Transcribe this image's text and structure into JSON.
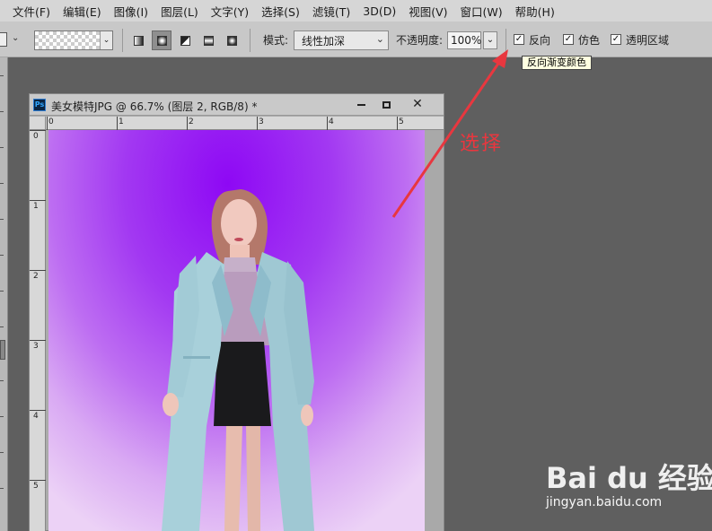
{
  "menu": [
    "文件(F)",
    "编辑(E)",
    "图像(I)",
    "图层(L)",
    "文字(Y)",
    "选择(S)",
    "滤镜(T)",
    "3D(D)",
    "视图(V)",
    "窗口(W)",
    "帮助(H)"
  ],
  "options": {
    "mode_label": "模式:",
    "mode_value": "线性加深",
    "opacity_label": "不透明度:",
    "opacity_value": "100%",
    "reverse_label": "反向",
    "dither_label": "仿色",
    "transparency_label": "透明区域",
    "reverse_checked": true,
    "dither_checked": true,
    "transparency_checked": true,
    "tooltip": "反向渐变颜色"
  },
  "document": {
    "title": "美女模特JPG @ 66.7% (图层 2, RGB/8) *",
    "app_icon": "Ps",
    "ruler_top": [
      "0",
      "1",
      "2",
      "3",
      "4",
      "5"
    ],
    "ruler_left": [
      "0",
      "1",
      "2",
      "3",
      "4",
      "5"
    ]
  },
  "annotation": {
    "text": "选择",
    "color": "#e8373f"
  },
  "watermark": {
    "logo": "Bai du 经验",
    "url": "jingyan.baidu.com"
  },
  "colors": {
    "accent_purple": "#8e08f4",
    "annotation_red": "#e8373f"
  }
}
